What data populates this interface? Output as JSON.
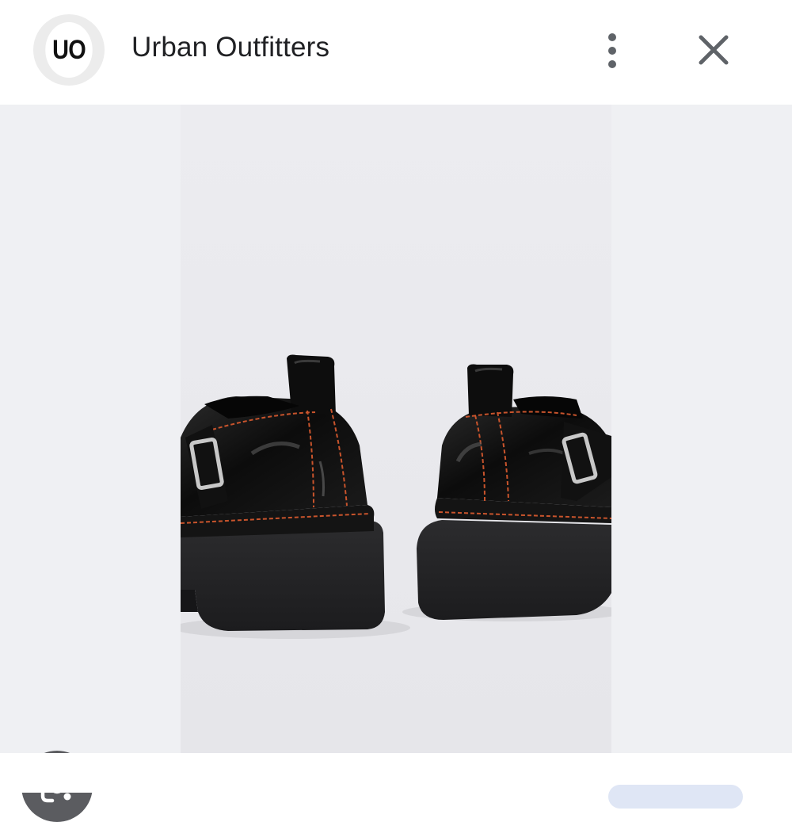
{
  "header": {
    "logo_text": "UO",
    "site_name": "Urban Outfitters",
    "more_icon": "more-vert-icon",
    "close_icon": "close-icon"
  },
  "viewer": {
    "image_subject": "black patent leather mary jane platform shoes with orange stitching, rear view",
    "lens_icon": "google-lens-icon"
  },
  "colors": {
    "header_bg": "#ffffff",
    "image_bg": "#eff0f3",
    "lens_bg": "#5b5c60",
    "stitch": "#d0502a"
  }
}
